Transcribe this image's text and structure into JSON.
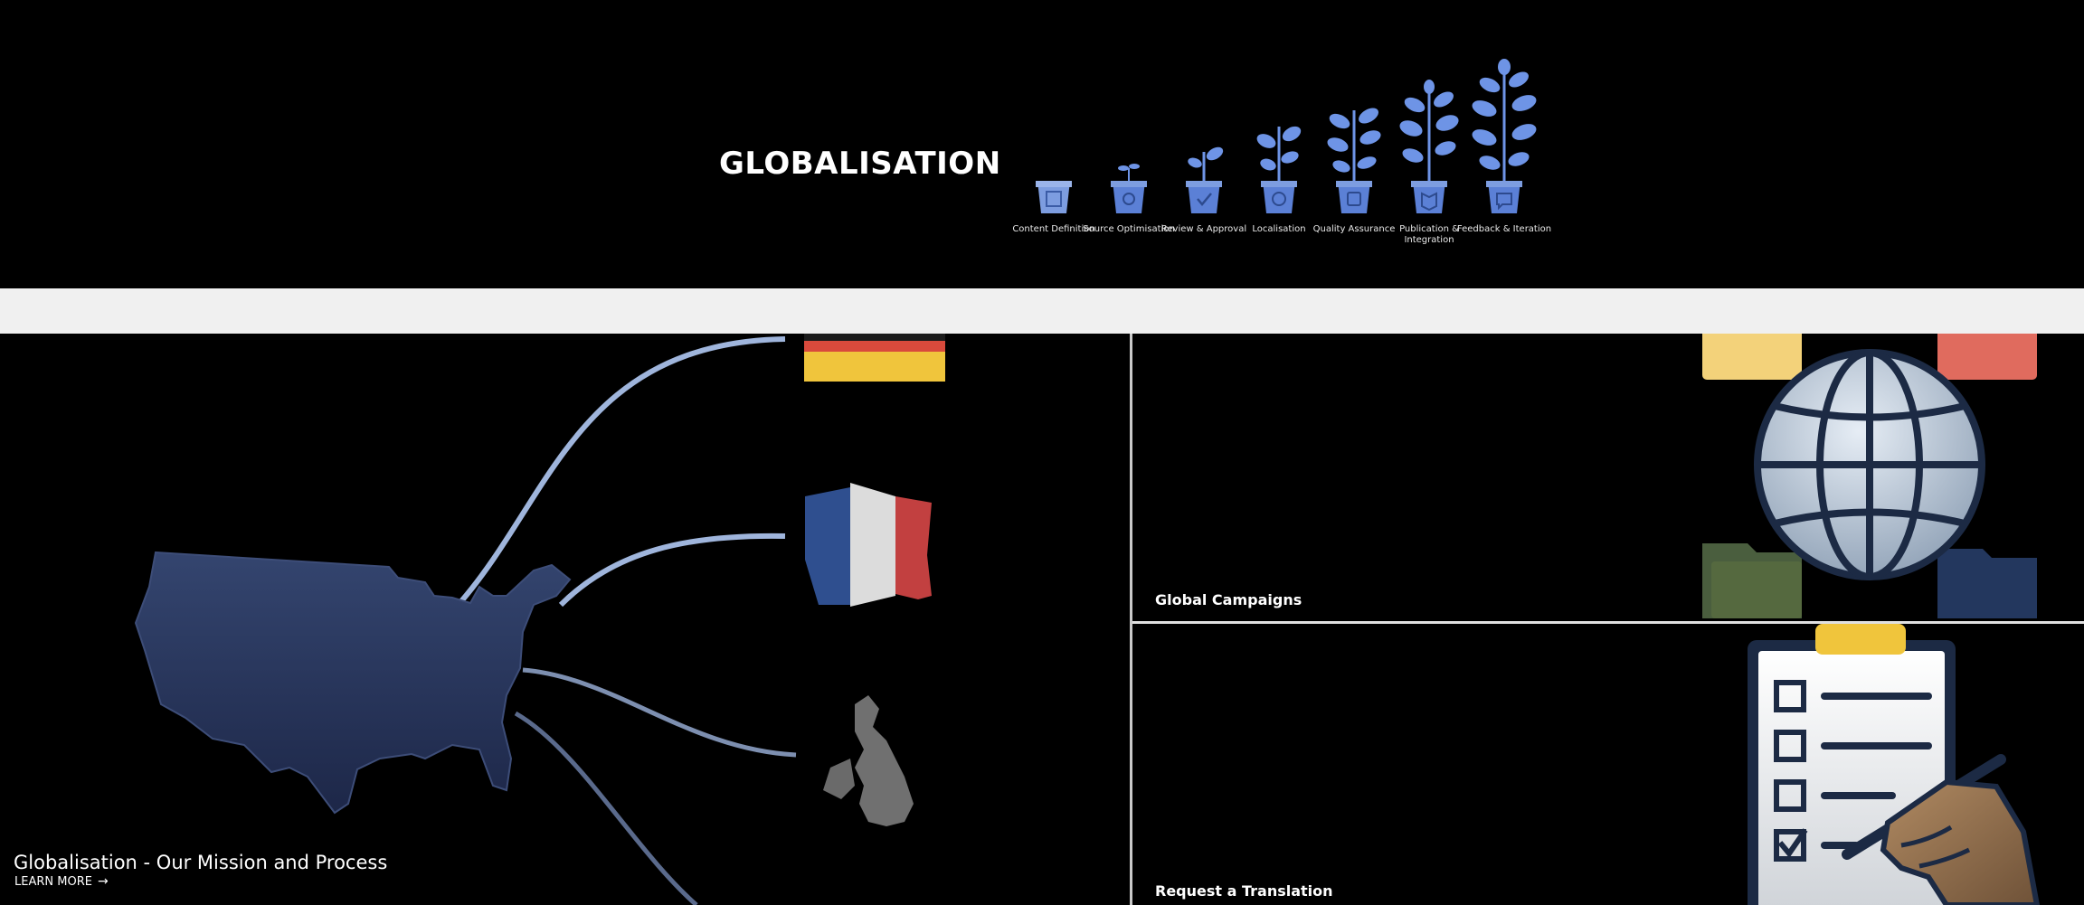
{
  "hero": {
    "title": "GLOBALISATION",
    "steps": [
      {
        "label": "Content Definition",
        "icon": "document-icon"
      },
      {
        "label": "Source Optimisation",
        "icon": "magnifier-icon"
      },
      {
        "label": "Review & Approval",
        "icon": "checkmark-icon"
      },
      {
        "label": "Localisation",
        "icon": "globe-icon"
      },
      {
        "label": "Quality Assurance",
        "icon": "badge-icon"
      },
      {
        "label": "Publication & Integration",
        "icon": "book-icon"
      },
      {
        "label": "Feedback & Iteration",
        "icon": "chat-icon"
      }
    ]
  },
  "tiles": {
    "mission": {
      "title": "Globalisation - Our Mission and Process",
      "cta": "LEARN MORE",
      "cta_icon": "arrow-right-icon"
    },
    "campaigns": {
      "title": "Global Campaigns"
    },
    "translation": {
      "title": "Request a Translation"
    }
  },
  "colors": {
    "background": "#000000",
    "band": "#f0f0f0",
    "pot_blue": "#5b80d6",
    "leaf_blue": "#6e94e6",
    "usa_navy": "#2b3a64",
    "curve_blue": "#9fb5dc",
    "flag_red": "#d94a3c",
    "flag_yellow": "#f0c53c",
    "globe_silver": "#b9c6d6",
    "folder_green": "#4a5e3e",
    "folder_navy": "#23375e"
  }
}
